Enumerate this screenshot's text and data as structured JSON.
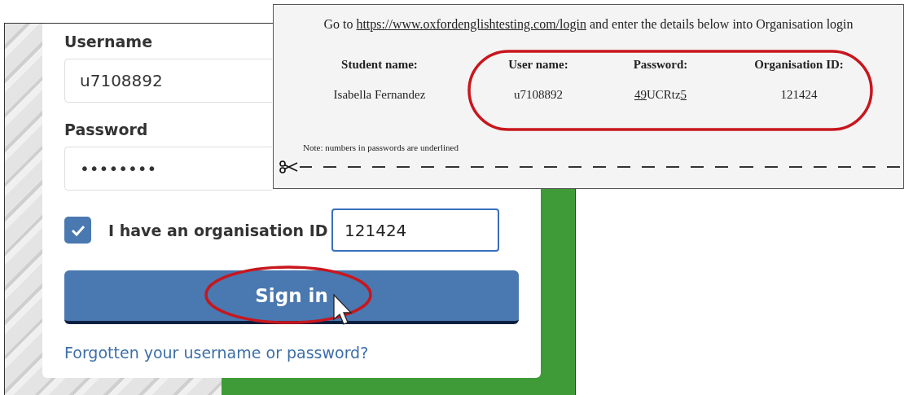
{
  "login_form": {
    "fields": [
      {
        "label": "Username",
        "value": "u7108892"
      },
      {
        "label": "Password",
        "value": "••••••••"
      }
    ],
    "org_checkbox": {
      "label": "I have an organisation ID",
      "checked": true
    },
    "org_id_field": {
      "value": "121424"
    },
    "sign_in_button": "Sign in",
    "forgot_link": "Forgotten your username or password?"
  },
  "instructions_slip": {
    "text_before": "Go to",
    "link": "https://www.oxfordenglishtesting.com/login",
    "text_after": "and enter the details below into Organisation login",
    "columns": [
      {
        "header": "Student name:",
        "value": [
          {
            "text": "Isabella Fernandez",
            "underlined": false
          }
        ]
      },
      {
        "header": "User name:",
        "value": [
          {
            "text": "u7108892",
            "underlined": false
          }
        ]
      },
      {
        "header": "Password:",
        "value": [
          {
            "text": "49",
            "underlined": true
          },
          {
            "text": "UCRtz",
            "underlined": false
          },
          {
            "text": "5",
            "underlined": true
          }
        ]
      },
      {
        "header": "Organisation ID:",
        "value": [
          {
            "text": "121424",
            "underlined": false
          }
        ]
      }
    ],
    "note": "Note: numbers in passwords are underlined"
  }
}
